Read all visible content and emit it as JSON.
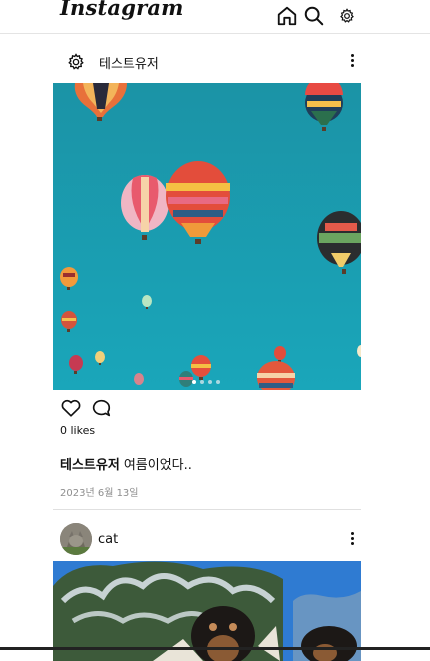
{
  "app": {
    "logo": "Instagram"
  },
  "nav": {
    "icons": [
      "home-icon",
      "search-icon",
      "settings-icon"
    ]
  },
  "posts": [
    {
      "username": "테스트유저",
      "avatar": "gear-icon",
      "likes": "0 likes",
      "caption_user": "테스트유저",
      "caption_text": "여름이었다..",
      "date": "2023년 6월 13일",
      "carousel": {
        "count": 4,
        "active": 1
      },
      "image": "hot-air-balloons-photo"
    },
    {
      "username": "cat",
      "avatar": "cat-photo",
      "image": "dogs-and-tree-photo"
    }
  ],
  "colors": {
    "sky": "#139cae",
    "divider": "#e0e0e0",
    "muted": "#8e8e8e"
  }
}
